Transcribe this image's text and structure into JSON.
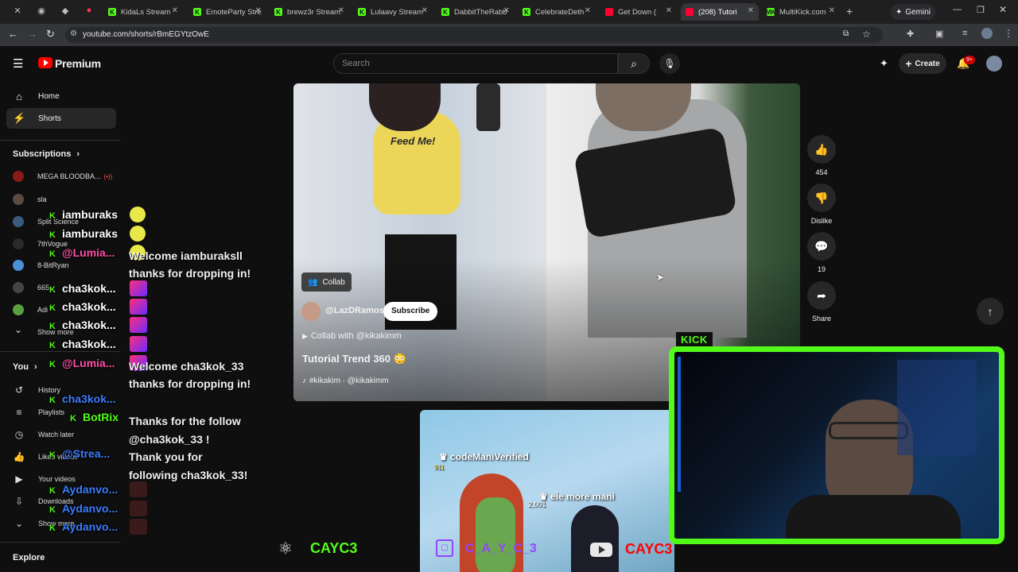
{
  "browser": {
    "tabs": [
      {
        "label": "KidaLs Stream",
        "color": "#53fc18",
        "icon": "kick-icon"
      },
      {
        "label": "EmoteParty Stre",
        "color": "#53fc18",
        "icon": "kick-icon"
      },
      {
        "label": "brewz3r Stream",
        "color": "#53fc18",
        "icon": "kick-icon"
      },
      {
        "label": "Lulaavy Stream",
        "color": "#53fc18",
        "icon": "kick-icon"
      },
      {
        "label": "DabbitTheRabb",
        "color": "#53fc18",
        "icon": "kick-icon"
      },
      {
        "label": "CelebrateDeth",
        "color": "#53fc18",
        "icon": "kick-icon"
      },
      {
        "label": "Get Down (",
        "color": "#ff0033",
        "icon": "youtube-icon"
      },
      {
        "label": "(208) Tutori",
        "color": "#ff0033",
        "icon": "youtube-icon"
      },
      {
        "label": "MultiKick.com",
        "color": "#53fc18",
        "icon": "multikick-icon"
      }
    ],
    "tab_fav_letters": {
      "kick": "K",
      "multikick": "MK"
    },
    "gemini_label": "Gemini",
    "url": "youtube.com/shorts/rBmEGYtzOwE"
  },
  "youtube": {
    "logo_text": "Premium",
    "search_placeholder": "Search",
    "create_label": "Create",
    "notif_badge": "9+",
    "nav": [
      {
        "label": "Home",
        "icon": "home-icon"
      },
      {
        "label": "Shorts",
        "icon": "shorts-icon"
      }
    ],
    "subscriptions_title": "Subscriptions",
    "subscriptions": [
      {
        "label": "MEGA BLOODBA...",
        "live": "(•))"
      },
      {
        "label": "sla"
      },
      {
        "label": "Split Science"
      },
      {
        "label": "7thVogue"
      },
      {
        "label": "8-BitRyan"
      },
      {
        "label": "665"
      },
      {
        "label": "Adi"
      },
      {
        "label": "Show more"
      }
    ],
    "you_title": "You",
    "you_items": [
      {
        "label": "History",
        "icon": "history-icon"
      },
      {
        "label": "Playlists",
        "icon": "playlists-icon"
      },
      {
        "label": "Watch later",
        "icon": "watch-later-icon"
      },
      {
        "label": "Liked videos",
        "icon": "liked-icon"
      },
      {
        "label": "Your videos",
        "icon": "your-videos-icon"
      },
      {
        "label": "Downloads",
        "icon": "downloads-icon"
      },
      {
        "label": "Show more",
        "icon": "chevron-down-icon"
      }
    ],
    "explore_title": "Explore"
  },
  "short": {
    "collab_label": "Collab",
    "channel": "@LazDRamos",
    "subscribe_label": "Subscribe",
    "collab_with": "Collab with @kikakimm",
    "title": "Tutorial Trend 360 😳",
    "tags": "#kikakim · @kikakimm",
    "likes": "454",
    "dislike_label": "Dislike",
    "comments": "19",
    "share_label": "Share",
    "shirt_text": "Feed Me!",
    "next_users": [
      "codeManiVerified",
      "eie more mani"
    ],
    "next_points": [
      "911",
      "2,001"
    ]
  },
  "chat": {
    "messages": [
      {
        "user": "iamburaks"
      },
      {
        "user": "iamburaks"
      },
      {
        "user": "@Lumia..."
      },
      {
        "user": "cha3kok..."
      },
      {
        "user": "cha3kok..."
      },
      {
        "user": "cha3kok..."
      },
      {
        "user": "cha3kok..."
      },
      {
        "user": "@Lumia..."
      },
      {
        "user": "cha3kok..."
      },
      {
        "user": "BotRix"
      },
      {
        "user": "@Strea..."
      },
      {
        "user": "Aydanvo..."
      },
      {
        "user": "Aydanvo..."
      },
      {
        "user": "Aydanvo..."
      }
    ],
    "texts": [
      "Welcome iamburaksll",
      "thanks for dropping in!",
      "Welcome cha3kok_33",
      "thanks for dropping in!",
      "Thanks for the follow",
      "@cha3kok_33 !",
      "Thank you for",
      "following cha3kok_33!"
    ]
  },
  "overlay": {
    "kick_label": "KICK",
    "socials": [
      {
        "label": "CAYC3",
        "icon": "atom-logo-icon"
      },
      {
        "label": "C_A_Y_C_3",
        "icon": "twitch-icon"
      },
      {
        "label": "CAYC3",
        "icon": "youtube-icon"
      }
    ],
    "colors": {
      "kick_green": "#53fc18",
      "yt_red": "#ff0000",
      "twitch_purple": "#9146ff"
    }
  }
}
